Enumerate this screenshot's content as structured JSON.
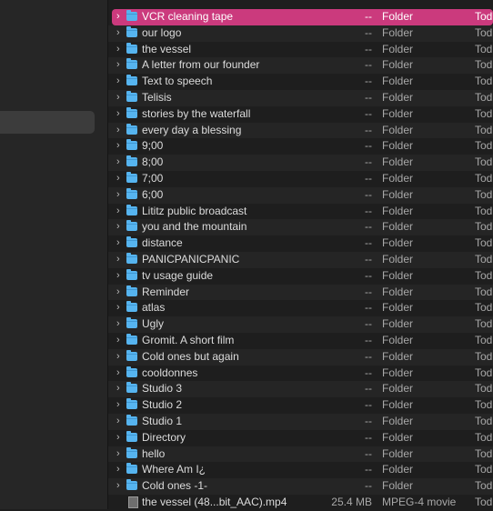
{
  "colors": {
    "selection": "#cb3a7d",
    "folder": "#56b4ef",
    "background": "#1e1e1e"
  },
  "rows": [
    {
      "name": "VCR cleaning tape",
      "size": "--",
      "kind": "Folder",
      "date": "Tod",
      "type": "folder",
      "selected": true
    },
    {
      "name": "our logo",
      "size": "--",
      "kind": "Folder",
      "date": "Tod",
      "type": "folder"
    },
    {
      "name": "the vessel",
      "size": "--",
      "kind": "Folder",
      "date": "Tod",
      "type": "folder"
    },
    {
      "name": "A letter from our founder",
      "size": "--",
      "kind": "Folder",
      "date": "Tod",
      "type": "folder"
    },
    {
      "name": "Text to speech",
      "size": "--",
      "kind": "Folder",
      "date": "Tod",
      "type": "folder"
    },
    {
      "name": "Telisis",
      "size": "--",
      "kind": "Folder",
      "date": "Tod",
      "type": "folder"
    },
    {
      "name": "stories by the waterfall",
      "size": "--",
      "kind": "Folder",
      "date": "Tod",
      "type": "folder"
    },
    {
      "name": "every day a blessing",
      "size": "--",
      "kind": "Folder",
      "date": "Tod",
      "type": "folder"
    },
    {
      "name": "9;00",
      "size": "--",
      "kind": "Folder",
      "date": "Tod",
      "type": "folder"
    },
    {
      "name": "8;00",
      "size": "--",
      "kind": "Folder",
      "date": "Tod",
      "type": "folder"
    },
    {
      "name": "7;00",
      "size": "--",
      "kind": "Folder",
      "date": "Tod",
      "type": "folder"
    },
    {
      "name": "6;00",
      "size": "--",
      "kind": "Folder",
      "date": "Tod",
      "type": "folder"
    },
    {
      "name": "Lititz public broadcast",
      "size": "--",
      "kind": "Folder",
      "date": "Tod",
      "type": "folder"
    },
    {
      "name": "you and the mountain",
      "size": "--",
      "kind": "Folder",
      "date": "Tod",
      "type": "folder"
    },
    {
      "name": "distance",
      "size": "--",
      "kind": "Folder",
      "date": "Tod",
      "type": "folder"
    },
    {
      "name": "PANICPANICPANIC",
      "size": "--",
      "kind": "Folder",
      "date": "Tod",
      "type": "folder"
    },
    {
      "name": "tv usage guide",
      "size": "--",
      "kind": "Folder",
      "date": "Tod",
      "type": "folder"
    },
    {
      "name": "Reminder",
      "size": "--",
      "kind": "Folder",
      "date": "Tod",
      "type": "folder"
    },
    {
      "name": "atlas",
      "size": "--",
      "kind": "Folder",
      "date": "Tod",
      "type": "folder"
    },
    {
      "name": "Ugly",
      "size": "--",
      "kind": "Folder",
      "date": "Tod",
      "type": "folder"
    },
    {
      "name": "Gromit. A short film",
      "size": "--",
      "kind": "Folder",
      "date": "Tod",
      "type": "folder"
    },
    {
      "name": "Cold ones but again",
      "size": "--",
      "kind": "Folder",
      "date": "Tod",
      "type": "folder"
    },
    {
      "name": "cooldonnes",
      "size": "--",
      "kind": "Folder",
      "date": "Tod",
      "type": "folder"
    },
    {
      "name": "Studio 3",
      "size": "--",
      "kind": "Folder",
      "date": "Tod",
      "type": "folder"
    },
    {
      "name": "Studio 2",
      "size": "--",
      "kind": "Folder",
      "date": "Tod",
      "type": "folder"
    },
    {
      "name": "Studio 1",
      "size": "--",
      "kind": "Folder",
      "date": "Tod",
      "type": "folder"
    },
    {
      "name": "Directory",
      "size": "--",
      "kind": "Folder",
      "date": "Tod",
      "type": "folder"
    },
    {
      "name": "hello",
      "size": "--",
      "kind": "Folder",
      "date": "Tod",
      "type": "folder"
    },
    {
      "name": "Where Am I¿",
      "size": "--",
      "kind": "Folder",
      "date": "Tod",
      "type": "folder"
    },
    {
      "name": "Cold ones -1-",
      "size": "--",
      "kind": "Folder",
      "date": "Tod",
      "type": "folder"
    },
    {
      "name": "the vessel (48...bit_AAC).mp4",
      "size": "25.4 MB",
      "kind": "MPEG-4 movie",
      "date": "Tod",
      "type": "file"
    }
  ]
}
